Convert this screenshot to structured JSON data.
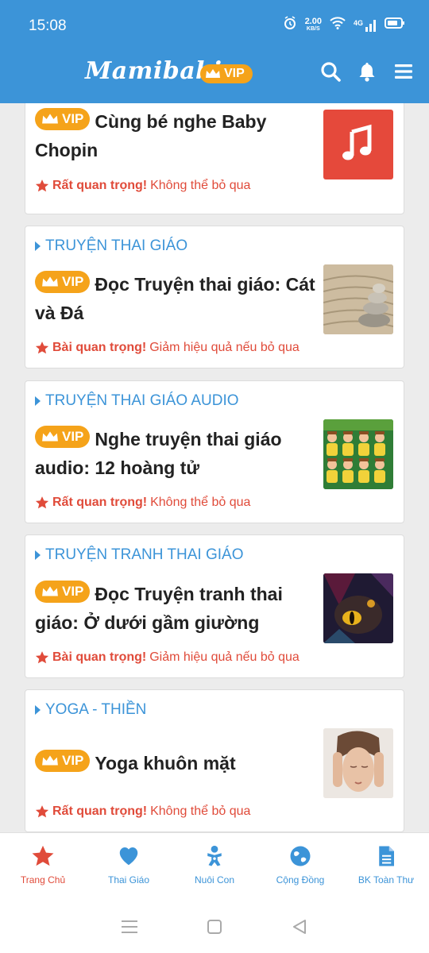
{
  "status": {
    "time": "15:08",
    "speed_value": "2.00",
    "speed_unit": "KB/S",
    "network": "4G"
  },
  "header": {
    "logo": "Mamibabi",
    "vip_label": "VIP"
  },
  "cards": [
    {
      "category": "",
      "vip": "VIP",
      "title": "Cùng bé nghe Baby Chopin",
      "importance": "Rất quan trọng!",
      "note": "Không thể bỏ qua",
      "thumb": "music-note"
    },
    {
      "category": "TRUYỆN THAI GIÁO",
      "vip": "VIP",
      "title": "Đọc Truyện thai giáo: Cát và Đá",
      "importance": "Bài quan trọng!",
      "note": "Giảm hiệu quả nếu bỏ qua",
      "thumb": "zen-stones"
    },
    {
      "category": "TRUYỆN THAI GIÁO AUDIO",
      "vip": "VIP",
      "title": "Nghe truyện thai giáo audio: 12 hoàng tử",
      "importance": "Rất quan trọng!",
      "note": "Không thể bỏ qua",
      "thumb": "twelve-princes"
    },
    {
      "category": "TRUYỆN TRANH THAI GIÁO",
      "vip": "VIP",
      "title": "Đọc Truyện tranh thai giáo: Ở dưới gầm giường",
      "importance": "Bài quan trọng!",
      "note": "Giảm hiệu quả nếu bỏ qua",
      "thumb": "monster-eye"
    },
    {
      "category": "YOGA - THIỀN",
      "vip": "VIP",
      "title": "Yoga khuôn mặt",
      "importance": "Rất quan trọng!",
      "note": "Không thể bỏ qua",
      "thumb": "face-massage"
    }
  ],
  "nav": [
    {
      "label": "Trang Chủ",
      "icon": "star-icon"
    },
    {
      "label": "Thai Giáo",
      "icon": "heart-icon"
    },
    {
      "label": "Nuôi Con",
      "icon": "baby-icon"
    },
    {
      "label": "Cộng Đồng",
      "icon": "globe-icon"
    },
    {
      "label": "BK Toàn Thư",
      "icon": "document-icon"
    }
  ],
  "colors": {
    "primary": "#3c94d8",
    "vip": "#f5a31a",
    "important": "#e04b3a"
  }
}
